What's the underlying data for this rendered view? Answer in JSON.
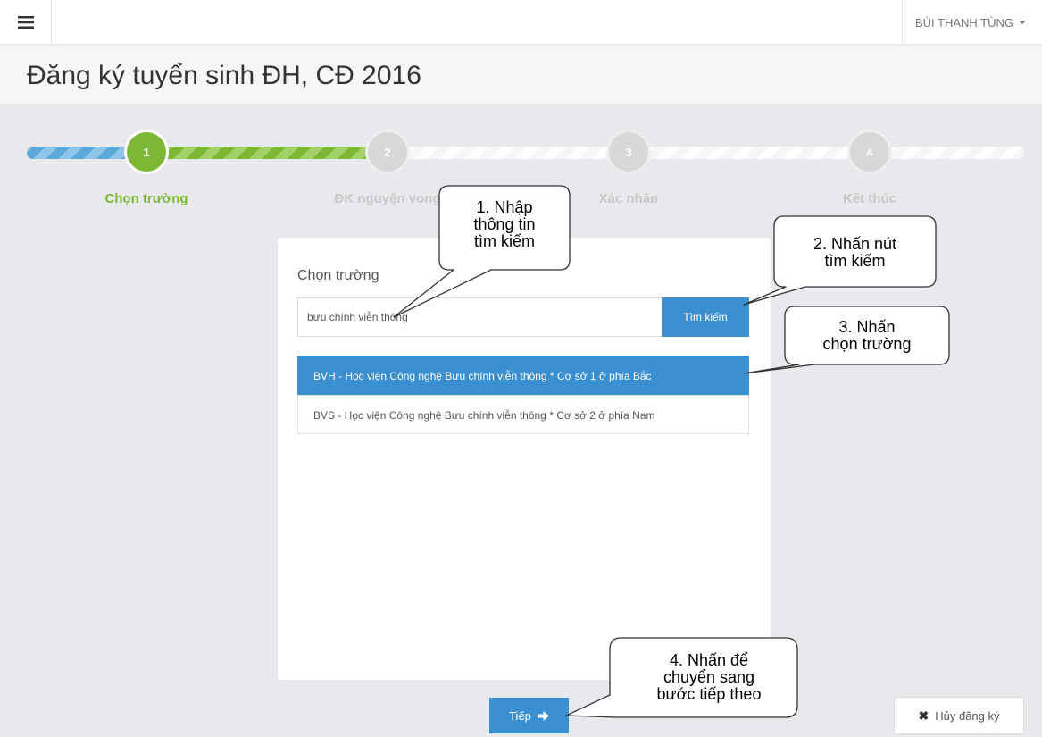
{
  "header": {
    "menu_icon": "hamburger-icon",
    "user_name": "BÙI THANH TÙNG"
  },
  "page": {
    "title": "Đăng ký tuyển sinh ĐH, CĐ 2016"
  },
  "wizard": {
    "steps": [
      {
        "number": "1",
        "label": "Chọn trường",
        "state": "current"
      },
      {
        "number": "2",
        "label": "ĐK nguyện vọng",
        "state": "pending"
      },
      {
        "number": "3",
        "label": "Xác nhận",
        "state": "pending"
      },
      {
        "number": "4",
        "label": "Kết thúc",
        "state": "pending"
      }
    ]
  },
  "form": {
    "label": "Chọn trường",
    "search_value": "bưu chính viễn thông",
    "search_button": "Tìm kiếm",
    "results": [
      {
        "text": "BVH - Học viện Công nghệ Bưu chính viễn thông * Cơ sở 1 ở phía Bắc",
        "selected": true
      },
      {
        "text": "BVS - Học viện Công nghệ Bưu chính viễn thông * Cơ sở 2 ở phía Nam",
        "selected": false
      }
    ]
  },
  "actions": {
    "next_label": "Tiếp",
    "next_icon": "arrow-right-icon",
    "cancel_label": "Hủy đăng ký",
    "cancel_icon": "close-icon"
  },
  "callouts": {
    "c1": "1. Nhập\nthông tin\ntìm kiếm",
    "c2": "2. Nhấn nút\ntìm kiếm",
    "c3": "3. Nhấn\nchọn trường",
    "c4": "4. Nhấn để\nchuyển sang\nbước tiếp theo"
  },
  "colors": {
    "primary": "#3a8fd1",
    "step_active": "#7cb833",
    "background": "#e8e9ec"
  }
}
